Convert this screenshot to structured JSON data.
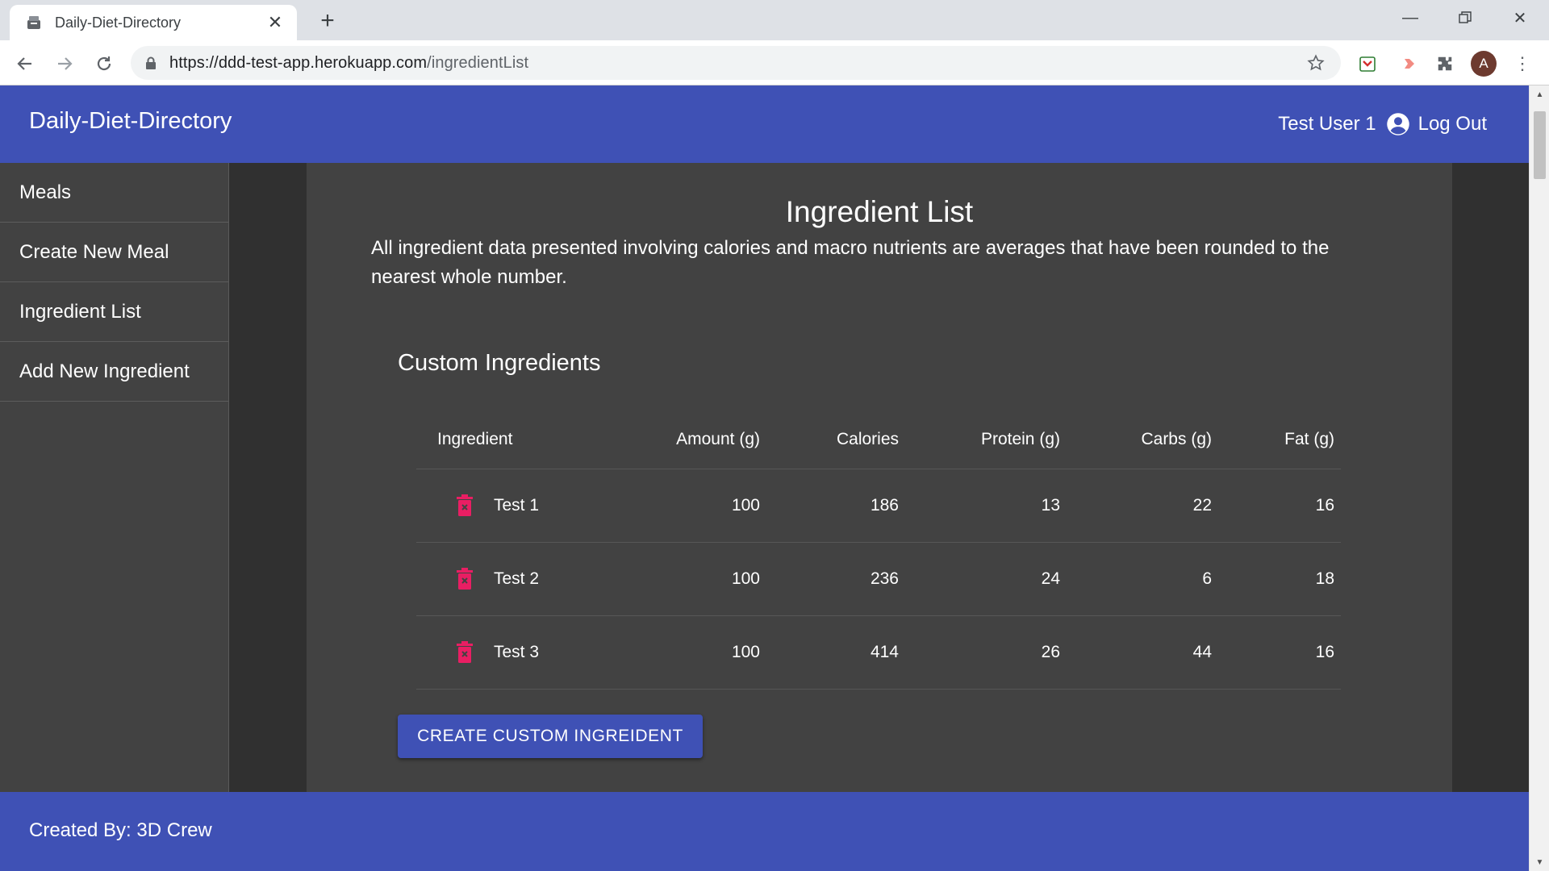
{
  "browser": {
    "tab_title": "Daily-Diet-Directory",
    "url_host": "https://ddd-test-app.herokuapp.com",
    "url_path": "/ingredientList",
    "avatar_letter": "A"
  },
  "header": {
    "brand": "Daily-Diet-Directory",
    "user_name": "Test User 1",
    "logout_label": "Log Out"
  },
  "sidebar": {
    "items": [
      {
        "label": "Meals"
      },
      {
        "label": "Create New Meal"
      },
      {
        "label": "Ingredient List"
      },
      {
        "label": "Add New Ingredient"
      }
    ]
  },
  "main": {
    "title": "Ingredient List",
    "disclaimer": "All ingredient data presented involving calories and macro nutrients are averages that have been rounded to the nearest whole number.",
    "section_title": "Custom Ingredients",
    "columns": [
      "Ingredient",
      "Amount (g)",
      "Calories",
      "Protein (g)",
      "Carbs (g)",
      "Fat (g)"
    ],
    "rows": [
      {
        "name": "Test 1",
        "amount": "100",
        "calories": "186",
        "protein": "13",
        "carbs": "22",
        "fat": "16"
      },
      {
        "name": "Test 2",
        "amount": "100",
        "calories": "236",
        "protein": "24",
        "carbs": "6",
        "fat": "18"
      },
      {
        "name": "Test 3",
        "amount": "100",
        "calories": "414",
        "protein": "26",
        "carbs": "44",
        "fat": "16"
      }
    ],
    "create_button": "CREATE CUSTOM INGREIDENT"
  },
  "footer": {
    "text": "Created By: 3D Crew"
  },
  "colors": {
    "primary": "#3f51b5",
    "surface": "#424242",
    "background": "#303030",
    "delete": "#e91e63"
  }
}
